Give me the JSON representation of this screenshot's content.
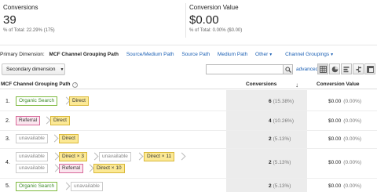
{
  "summary": {
    "conversions": {
      "label": "Conversions",
      "value": "39",
      "sub": "% of Total: 22.29% (175)"
    },
    "conversion_value": {
      "label": "Conversion Value",
      "value": "$0.00",
      "sub": "% of Total: 0.00% ($0.00)"
    }
  },
  "dimensions": {
    "label": "Primary Dimension:",
    "current": "MCF Channel Grouping Path",
    "links": [
      "Source/Medium Path",
      "Source Path",
      "Medium Path",
      "Other",
      "Channel Groupings"
    ]
  },
  "toolbar": {
    "secondary_dimension": "Secondary dimension",
    "search_placeholder": "",
    "advanced": "advanced"
  },
  "table": {
    "headers": {
      "path": "MCF Channel Grouping Path",
      "help": "?",
      "conversions": "Conversions",
      "value": "Conversion Value"
    },
    "rows": [
      {
        "num": "1.",
        "conversions": "6",
        "conv_pct": "(15.38%)",
        "value": "$0.00",
        "value_pct": "(0.00%)",
        "tags": [
          "Organic Search",
          "Direct"
        ]
      },
      {
        "num": "2.",
        "conversions": "4",
        "conv_pct": "(10.26%)",
        "value": "$0.00",
        "value_pct": "(0.00%)",
        "tags": [
          "Referral",
          "Direct"
        ]
      },
      {
        "num": "3.",
        "conversions": "2",
        "conv_pct": "(5.13%)",
        "value": "$0.00",
        "value_pct": "(0.00%)",
        "tags": [
          "unavailable",
          "Direct"
        ]
      },
      {
        "num": "4.",
        "conversions": "2",
        "conv_pct": "(5.13%)",
        "value": "$0.00",
        "value_pct": "(0.00%)",
        "tags": [
          "unavailable",
          "Direct × 3",
          "unavailable",
          "Direct × 11",
          "unavailable",
          "Referral",
          "Direct × 10"
        ]
      },
      {
        "num": "5.",
        "conversions": "2",
        "conv_pct": "(5.13%)",
        "value": "$0.00",
        "value_pct": "(0.00%)",
        "tags": [
          "Organic Search",
          "unavailable"
        ]
      }
    ]
  },
  "colors": {
    "link": "#1a5fb4",
    "organic": "#7fba3f",
    "direct": "#fce995",
    "referral": "#d86a9a"
  }
}
